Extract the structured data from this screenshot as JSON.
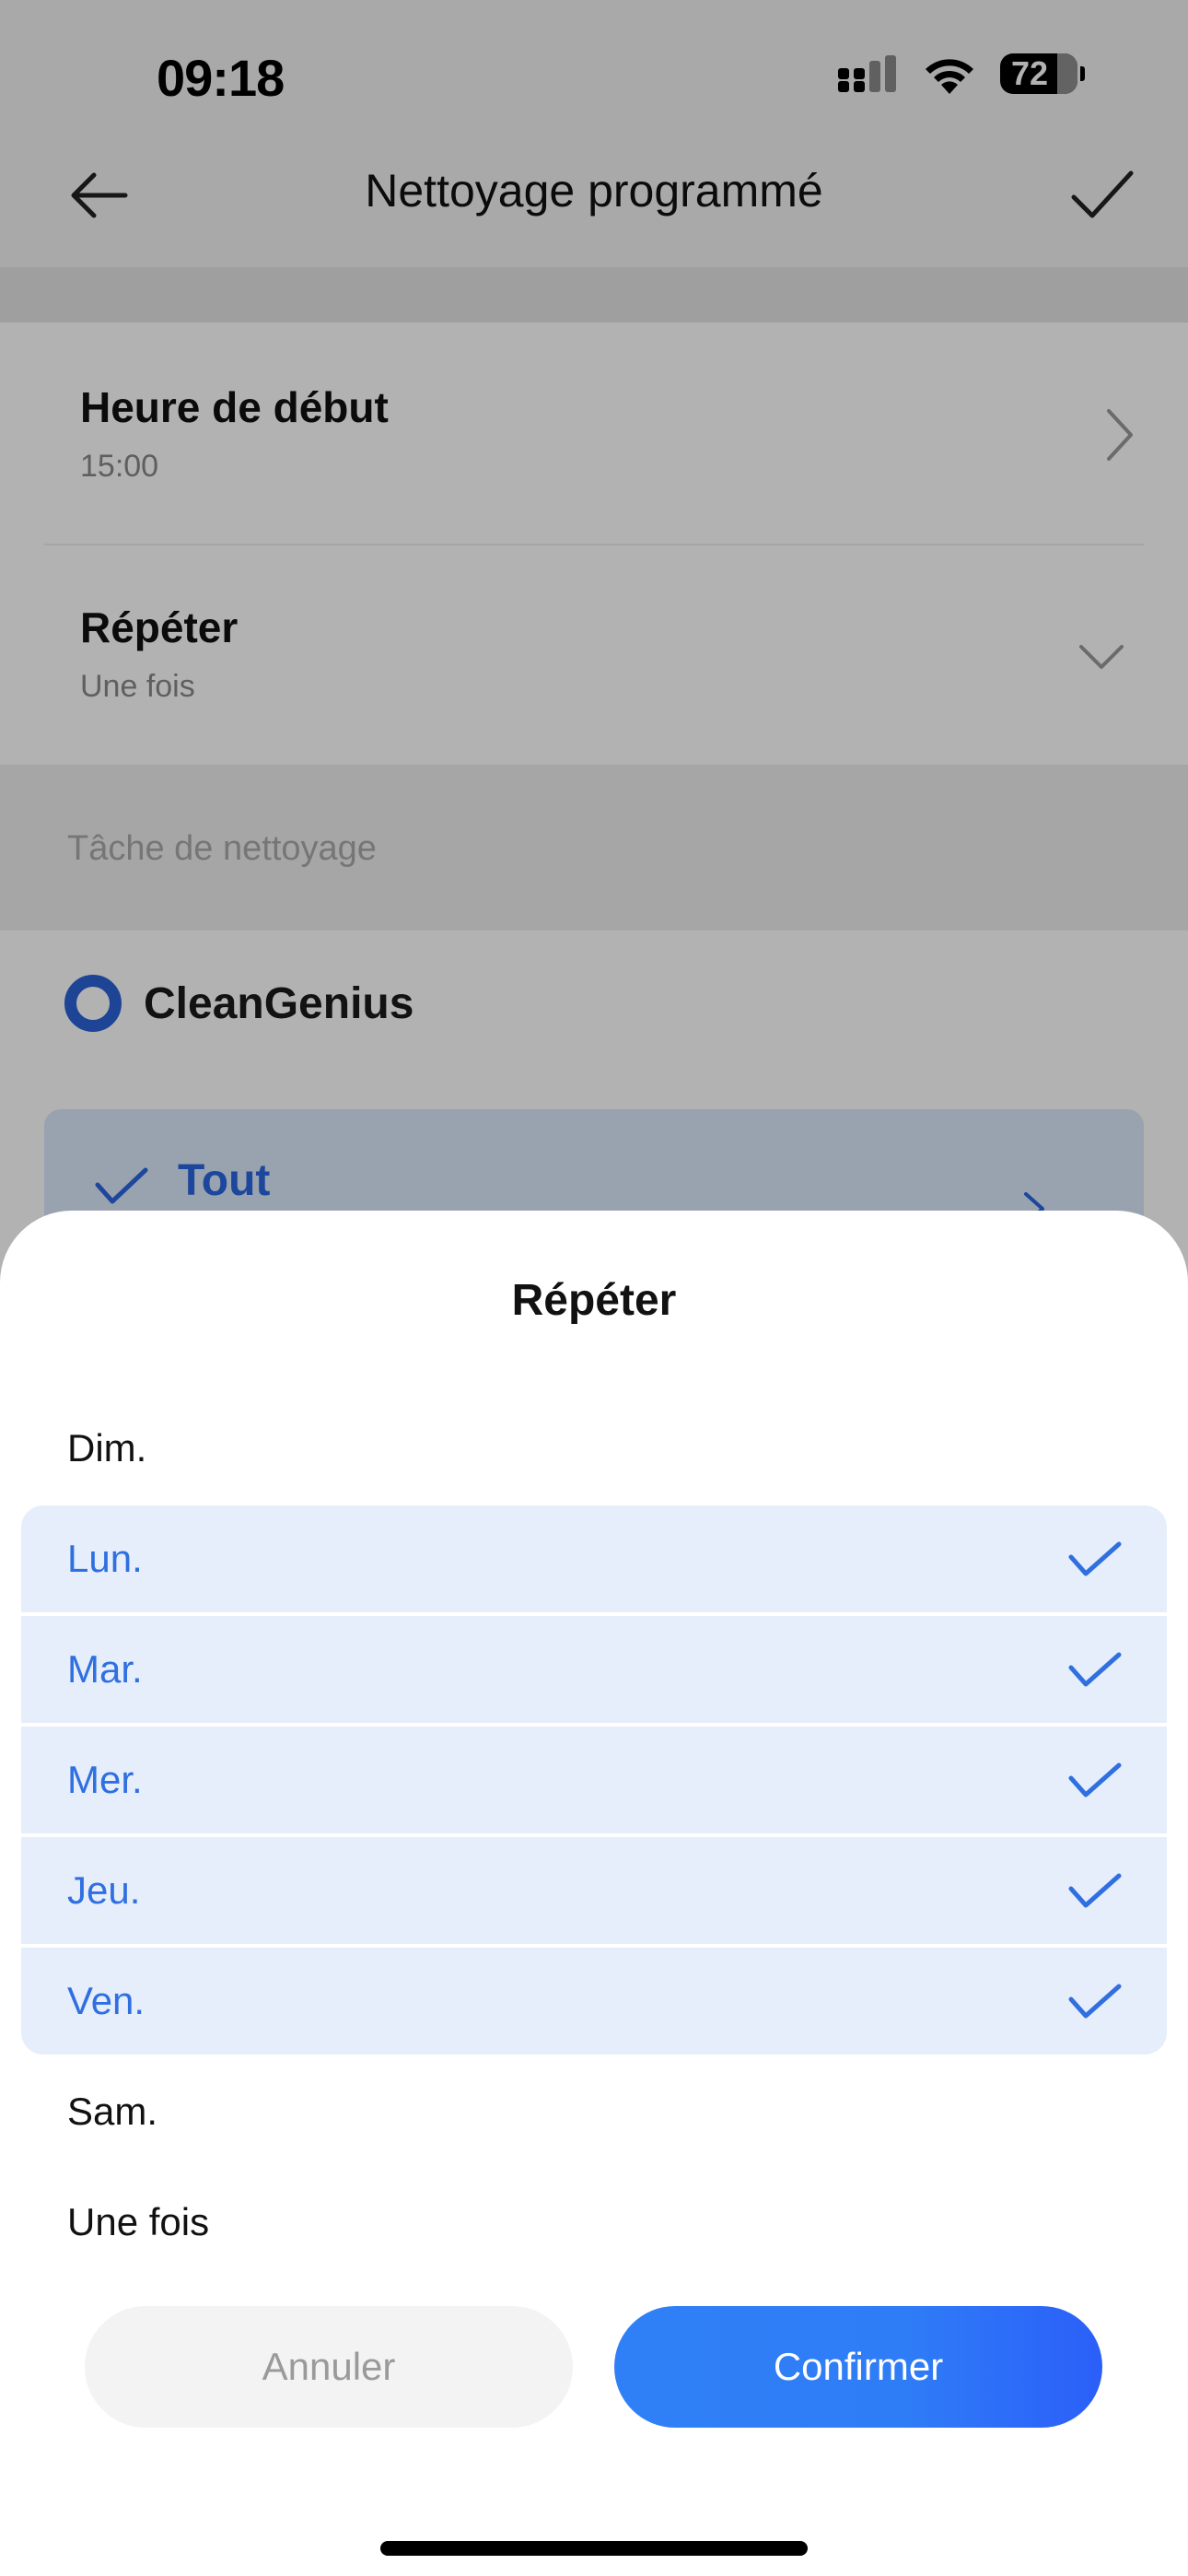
{
  "status_bar": {
    "time": "09:18",
    "battery": "72"
  },
  "nav": {
    "title": "Nettoyage programmé"
  },
  "settings": {
    "start_time_title": "Heure de début",
    "start_time_value": "15:00",
    "repeat_title": "Répéter",
    "repeat_value": "Une fois"
  },
  "section": {
    "label": "Tâche de nettoyage",
    "clean_mode": "CleanGenius",
    "area": "Tout"
  },
  "sheet": {
    "title": "Répéter",
    "options": [
      {
        "label": "Dim.",
        "selected": false
      },
      {
        "label": "Lun.",
        "selected": true
      },
      {
        "label": "Mar.",
        "selected": true
      },
      {
        "label": "Mer.",
        "selected": true
      },
      {
        "label": "Jeu.",
        "selected": true
      },
      {
        "label": "Ven.",
        "selected": true
      },
      {
        "label": "Sam.",
        "selected": false
      },
      {
        "label": "Une fois",
        "selected": false
      }
    ],
    "cancel_label": "Annuler",
    "confirm_label": "Confirmer"
  },
  "colors": {
    "accent": "#2f6fe0",
    "selected_bg": "#e6eefc",
    "confirm_gradient_start": "#2f80f6",
    "confirm_gradient_end": "#2b5ff8"
  },
  "icons": [
    "back-arrow-icon",
    "checkmark-icon",
    "chevron-right-icon",
    "chevron-down-icon",
    "radio-icon",
    "cellular-signal-icon",
    "wifi-icon",
    "battery-icon"
  ]
}
